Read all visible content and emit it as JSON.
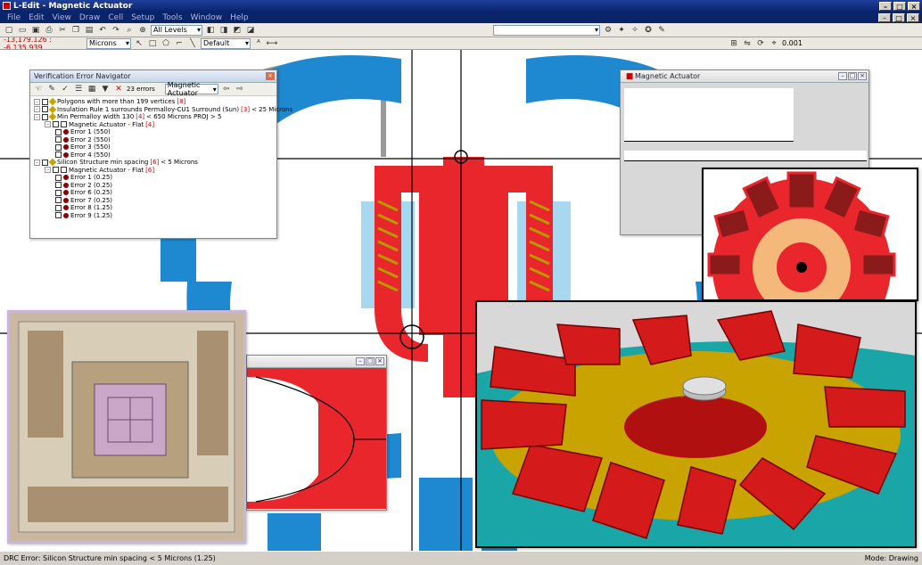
{
  "app": {
    "title": "L-Edit - Magnetic Actuator",
    "menus": [
      "File",
      "Edit",
      "View",
      "Draw",
      "Cell",
      "Setup",
      "Tools",
      "Window",
      "Help"
    ]
  },
  "toolbar": {
    "levels_combo": "All Levels",
    "units_combo": "Microns",
    "layer_combo": "Default",
    "coordinates": "-13,179.126 : -6,135.939",
    "snap_value": "0.001"
  },
  "navigator": {
    "title": "Verification Error Navigator",
    "error_count": "23 errors",
    "cell_combo": "Magnetic Actuator",
    "tree": [
      {
        "level": 0,
        "kind": "rule",
        "label": "Polygons with more than 199 vertices",
        "count": "[8]",
        "tail": ""
      },
      {
        "level": 0,
        "kind": "rule",
        "label": "Insulation Rule 1 surrounds Permalloy-CU1 Surround (Sun)",
        "count": "[3]",
        "tail": "< 25 Microns"
      },
      {
        "level": 0,
        "kind": "rule",
        "label": "Min Permalloy width 130",
        "count": "[4]",
        "tail": "< 650 Microns PROJ > 5"
      },
      {
        "level": 1,
        "kind": "cell",
        "label": "Magnetic Actuator - Flat",
        "count": "[4]",
        "tail": ""
      },
      {
        "level": 2,
        "kind": "error",
        "label": "Error 1 (550)",
        "count": "",
        "tail": ""
      },
      {
        "level": 2,
        "kind": "error",
        "label": "Error 2 (550)",
        "count": "",
        "tail": ""
      },
      {
        "level": 2,
        "kind": "error",
        "label": "Error 3 (550)",
        "count": "",
        "tail": ""
      },
      {
        "level": 2,
        "kind": "error",
        "label": "Error 4 (550)",
        "count": "",
        "tail": ""
      },
      {
        "level": 0,
        "kind": "rule",
        "label": "Silicon Structure min spacing",
        "count": "[6]",
        "tail": "< 5 Microns"
      },
      {
        "level": 1,
        "kind": "cell",
        "label": "Magnetic Actuator - Flat",
        "count": "[6]",
        "tail": ""
      },
      {
        "level": 2,
        "kind": "error",
        "label": "Error 1 (0.25)",
        "count": "",
        "tail": ""
      },
      {
        "level": 2,
        "kind": "error",
        "label": "Error 2 (0.25)",
        "count": "",
        "tail": ""
      },
      {
        "level": 2,
        "kind": "error",
        "label": "Error 6 (0.25)",
        "count": "",
        "tail": ""
      },
      {
        "level": 2,
        "kind": "error",
        "label": "Error 7 (0.25)",
        "count": "",
        "tail": ""
      },
      {
        "level": 2,
        "kind": "error",
        "label": "Error 8 (1.25)",
        "count": "",
        "tail": ""
      },
      {
        "level": 2,
        "kind": "error",
        "label": "Error 9 (1.25)",
        "count": "",
        "tail": ""
      }
    ]
  },
  "actuator_window": {
    "title": "Magnetic Actuator"
  },
  "status": {
    "message": "DRC Error: Silicon Structure min spacing < 5 Microns (1.25)",
    "mode": "Mode: Drawing"
  },
  "colors": {
    "layout_blue": "#1e88d0",
    "layout_red": "#e8262c",
    "teal": "#1aa6a6",
    "dark_red": "#b01010"
  }
}
